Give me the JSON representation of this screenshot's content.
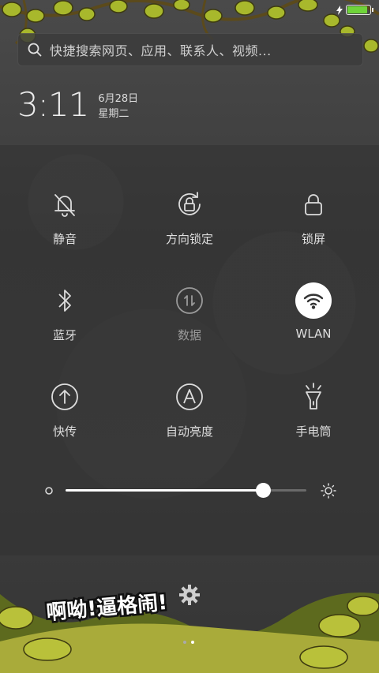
{
  "status": {
    "charging": true,
    "battery_level": 0.95,
    "battery_color": "#6fd43a"
  },
  "search": {
    "placeholder": "快捷搜索网页、应用、联系人、视频..."
  },
  "clock": {
    "time": "3:11",
    "date": "6月28日",
    "weekday": "星期二"
  },
  "toggles": [
    {
      "label": "静音",
      "icon": "bell-off-icon",
      "active": false
    },
    {
      "label": "方向锁定",
      "icon": "rotation-lock-icon",
      "active": false
    },
    {
      "label": "锁屏",
      "icon": "lock-icon",
      "active": false
    },
    {
      "label": "蓝牙",
      "icon": "bluetooth-icon",
      "active": false
    },
    {
      "label": "数据",
      "icon": "mobile-data-icon",
      "active": false,
      "disabled": true
    },
    {
      "label": "WLAN",
      "icon": "wifi-icon",
      "active": true
    },
    {
      "label": "快传",
      "icon": "quick-transfer-icon",
      "active": false
    },
    {
      "label": "自动亮度",
      "icon": "auto-brightness-icon",
      "active": false
    },
    {
      "label": "手电筒",
      "icon": "flashlight-icon",
      "active": false
    }
  ],
  "brightness": {
    "level": 0.82
  },
  "page_indicator": {
    "count": 2,
    "current": 2
  },
  "theme_logo_text": "啊呦!逼格闹!"
}
